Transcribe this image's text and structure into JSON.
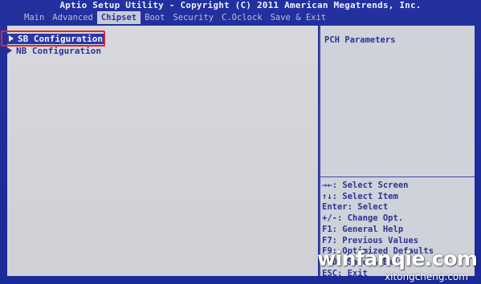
{
  "title": "Aptio Setup Utility - Copyright (C) 2011 American Megatrends, Inc.",
  "menu_tabs": [
    "Main",
    "Advanced",
    "Chipset",
    "Boot",
    "Security",
    "C.Oclock",
    "Save & Exit"
  ],
  "active_tab": "Chipset",
  "items": [
    {
      "label": "SB Configuration",
      "selected": true
    },
    {
      "label": "NB Configuration",
      "selected": false
    }
  ],
  "help": {
    "title": "PCH Parameters"
  },
  "keys": [
    "→←: Select Screen",
    "↑↓: Select Item",
    "Enter: Select",
    "+/-: Change Opt.",
    "F1: General Help",
    "F7: Previous Values",
    "F9: Optimized Defaults",
    "F10: Save & Exit",
    "ESC: Exit"
  ],
  "watermark": {
    "main": "winfanqie.com",
    "sub": "xitongcheng.com"
  },
  "colors": {
    "background": "#1c2a99",
    "panel": "#d3d5db",
    "text": "#2a3596",
    "highlight_box": "#e0242b"
  },
  "icons": {
    "submenu_arrow": "triangle-right-icon"
  }
}
